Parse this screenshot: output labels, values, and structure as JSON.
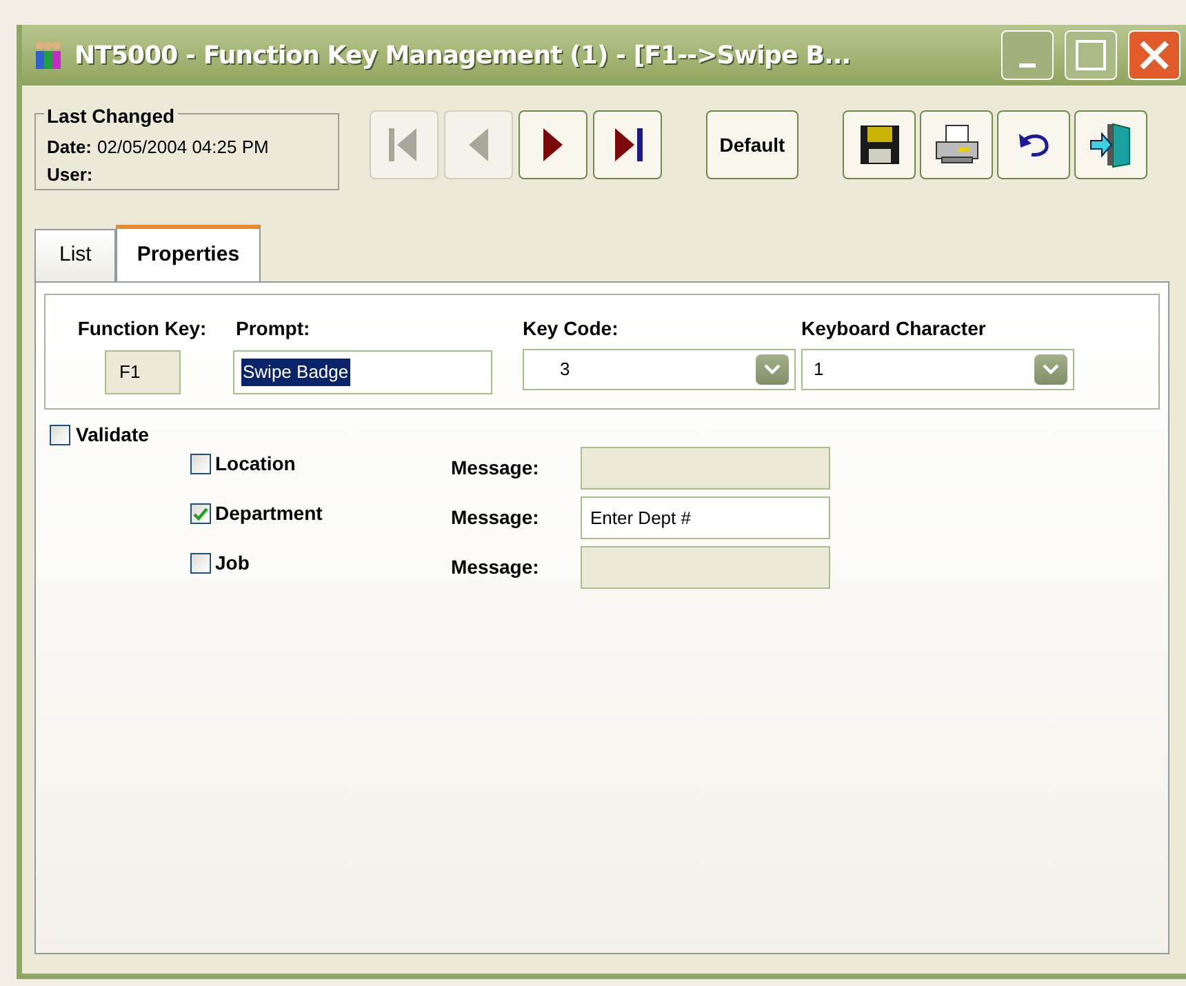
{
  "window": {
    "title": "NT5000 - Function Key Management (1) - [F1-->Swipe B..."
  },
  "last_changed": {
    "title": "Last Changed",
    "date_label": "Date:",
    "date": "02/05/2004 04:25 PM",
    "user_label": "User:"
  },
  "nav_buttons": [
    {
      "kind": "first",
      "disabled": true
    },
    {
      "kind": "prev",
      "disabled": true
    },
    {
      "kind": "next",
      "disabled": false
    },
    {
      "kind": "last",
      "disabled": false
    }
  ],
  "default_button": {
    "label": "Default"
  },
  "toolbar": [
    {
      "kind": "save"
    },
    {
      "kind": "print"
    },
    {
      "kind": "undo"
    },
    {
      "kind": "exit"
    }
  ],
  "tabs": [
    {
      "label": "List",
      "selected": false
    },
    {
      "label": "Properties",
      "selected": true
    }
  ],
  "fields": {
    "function_key": {
      "label": "Function Key:",
      "value": "F1"
    },
    "prompt": {
      "label": "Prompt:",
      "value": "Swipe Badge"
    },
    "key_code": {
      "label": "Key Code:",
      "value": "3"
    },
    "keyboard_character": {
      "label": "Keyboard Character",
      "value": "1"
    }
  },
  "validate": {
    "label": "Validate",
    "checked": false
  },
  "validations": [
    {
      "label": "Location",
      "checked": false,
      "message_label": "Message:"
    },
    {
      "label": "Department",
      "checked": true,
      "message_label": "Message:",
      "message": "Enter Dept #"
    },
    {
      "label": "Job",
      "checked": false,
      "message_label": "Message:"
    }
  ]
}
